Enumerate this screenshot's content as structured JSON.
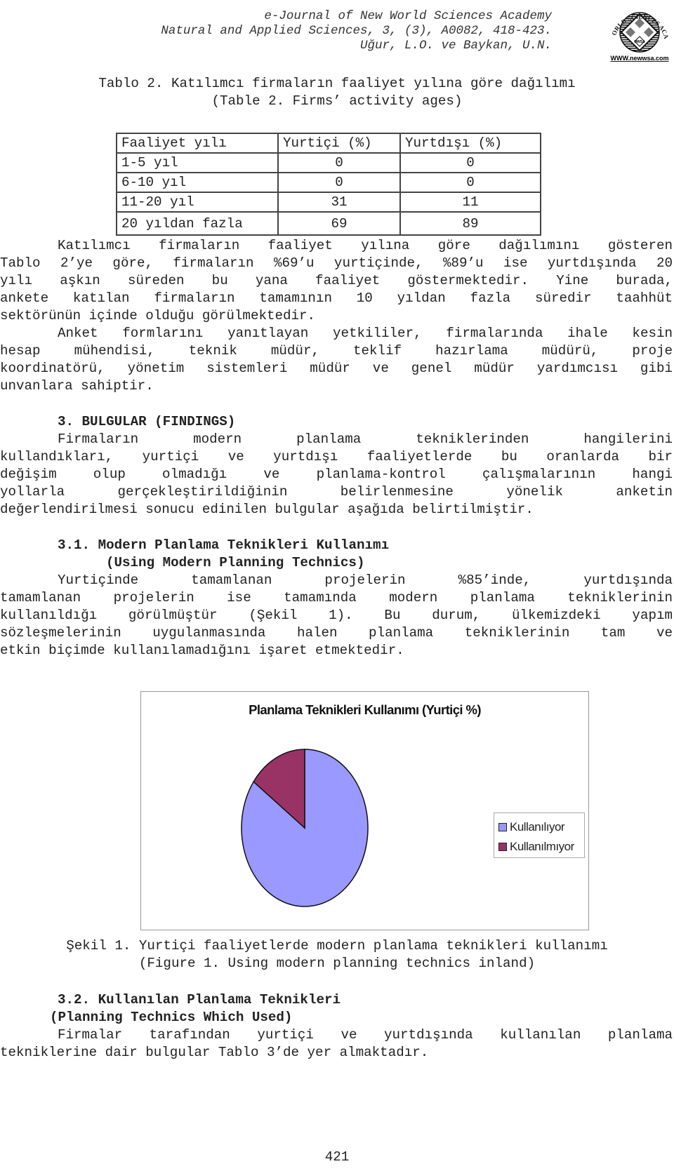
{
  "header": {
    "journal": "e-Journal of New World Sciences Academy",
    "citation": "Natural and Applied Sciences, 3, (3), A0082, 418-423.",
    "authors": "Uğur, L.O. ve Baykan, U.N.",
    "logo": {
      "top_text": "NEW WORLD SCIENCES ACADEMY",
      "center_text": "NWSA",
      "url_text": "WWW.newwsa.com"
    }
  },
  "table2": {
    "title": "Tablo 2. Katılımcı firmaların faaliyet yılına göre dağılımı",
    "subtitle": "(Table 2. Firms’ activity ages)",
    "headers": [
      "Faaliyet yılı",
      "Yurtiçi (%)",
      "Yurtdışı (%)"
    ],
    "rows": [
      [
        "1-5 yıl",
        "0",
        "0"
      ],
      [
        "6-10 yıl",
        "0",
        "0"
      ],
      [
        "11-20 yıl",
        "31",
        "11"
      ],
      [
        "20 yıldan fazla",
        "69",
        "89"
      ]
    ]
  },
  "para1": [
    "Katılımcı firmaların faaliyet yılına göre dağılımını gösteren",
    "Tablo 2’ye göre, firmaların %69’u yurtiçinde, %89’u ise yurtdışında 20",
    "yılı aşkın süreden bu yana faaliyet göstermektedir. Yine burada,",
    "ankete katılan firmaların tamamının 10 yıldan fazla süredir taahhüt",
    "sektörünün içinde olduğu görülmektedir."
  ],
  "para2": [
    "Anket formlarını yanıtlayan yetkililer, firmalarında ihale kesin",
    "hesap mühendisi, teknik müdür, teklif hazırlama müdürü, proje",
    "koordinatörü, yönetim sistemleri müdür ve genel müdür yardımcısı gibi",
    "unvanlara sahiptir."
  ],
  "section3": {
    "heading": "3. BULGULAR (FINDINGS)",
    "para": [
      "Firmaların modern planlama tekniklerinden hangilerini",
      "kullandıkları, yurtiçi ve yurtdışı faaliyetlerde bu oranlarda bir",
      "değişim olup olmadığı ve planlama-kontrol çalışmalarının hangi",
      "yollarla gerçekleştirildiğinin belirlenmesine yönelik anketin",
      "değerlendirilmesi sonucu edinilen bulgular aşağıda belirtilmiştir."
    ]
  },
  "section31": {
    "heading": "3.1. Modern Planlama Teknikleri Kullanımı",
    "subheading": "(Using Modern Planning Technics)",
    "para": [
      "Yurtiçinde tamamlanan projelerin %85’inde, yurtdışında",
      "tamamlanan projelerin ise tamamında modern planlama tekniklerinin",
      "kullanıldığı görülmüştür (Şekil 1).  Bu durum, ülkemizdeki yapım",
      "sözleşmelerinin uygulanmasında halen planlama tekniklerinin tam ve",
      "etkin biçimde kullanılamadığını işaret etmektedir."
    ]
  },
  "chart_data": {
    "type": "pie",
    "title": "Planlama Teknikleri Kullanımı (Yurtiçi %)",
    "categories": [
      "Kullanılıyor",
      "Kullanılmıyor"
    ],
    "values": [
      85,
      15
    ],
    "colors": [
      "#9999ff",
      "#993366"
    ],
    "start": "12 o'clock",
    "direction": "clockwise",
    "legend": "right"
  },
  "figure1": {
    "caption": "Şekil 1. Yurtiçi faaliyetlerde modern planlama teknikleri kullanımı",
    "caption_en": "(Figure 1. Using modern planning technics inland)"
  },
  "section32": {
    "heading": "3.2. Kullanılan Planlama Teknikleri",
    "subheading": "(Planning Technics Which Used)",
    "para": [
      "Firmalar tarafından yurtiçi ve yurtdışında kullanılan planlama",
      "tekniklerine dair bulgular Tablo 3’de yer almaktadır."
    ]
  },
  "footer": {
    "page_number": "421"
  }
}
